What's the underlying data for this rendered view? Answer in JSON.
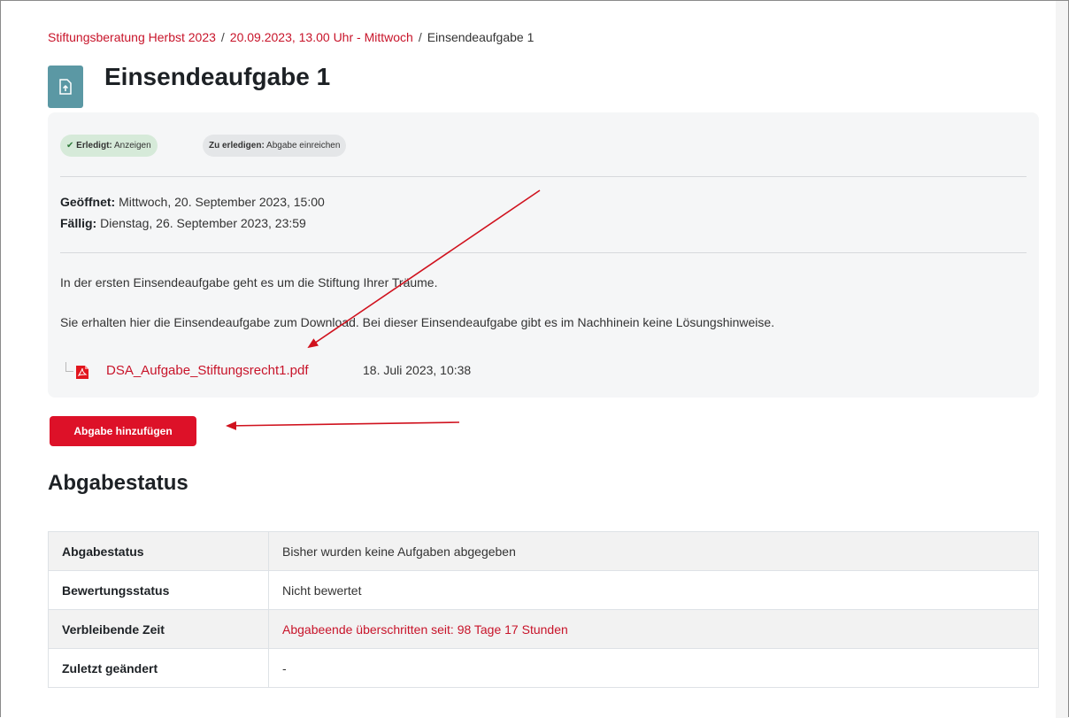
{
  "breadcrumb": {
    "items": [
      "Stiftungsberatung Herbst 2023",
      "20.09.2023, 13.00 Uhr - Mittwoch"
    ],
    "separator": "/",
    "current": "Einsendeaufgabe 1"
  },
  "page": {
    "title": "Einsendeaufgabe 1",
    "icon": "assignment-upload-icon"
  },
  "badges": {
    "done": {
      "check": "✔",
      "label": "Erledigt:",
      "value": "Anzeigen"
    },
    "todo": {
      "label": "Zu erledigen:",
      "value": "Abgabe einreichen"
    }
  },
  "dates": {
    "opened_label": "Geöffnet:",
    "opened_value": "Mittwoch, 20. September 2023, 15:00",
    "due_label": "Fällig:",
    "due_value": "Dienstag, 26. September 2023, 23:59"
  },
  "description": {
    "line1": "In der ersten Einsendeaufgabe geht es um die Stiftung Ihrer Träume.",
    "line2": "Sie erhalten hier die Einsendeaufgabe zum Download. Bei dieser Einsendeaufgabe gibt es im Nachhinein keine Lösungshinweise."
  },
  "attachment": {
    "filename": "DSA_Aufgabe_Stiftungsrecht1.pdf",
    "date": "18. Juli 2023, 10:38",
    "icon": "pdf-file-icon"
  },
  "actions": {
    "add_submission": "Abgabe hinzufügen"
  },
  "status": {
    "heading": "Abgabestatus",
    "rows": [
      {
        "label": "Abgabestatus",
        "value": "Bisher wurden keine Aufgaben abgegeben"
      },
      {
        "label": "Bewertungsstatus",
        "value": "Nicht bewertet"
      },
      {
        "label": "Verbleibende Zeit",
        "value": "Abgabeende überschritten seit: 98 Tage 17 Stunden"
      },
      {
        "label": "Zuletzt geändert",
        "value": "-"
      }
    ]
  },
  "colors": {
    "link": "#c8142a",
    "button": "#dd1128",
    "icon_bg": "#5b98a4",
    "annotation_arrow": "#d0121e"
  }
}
